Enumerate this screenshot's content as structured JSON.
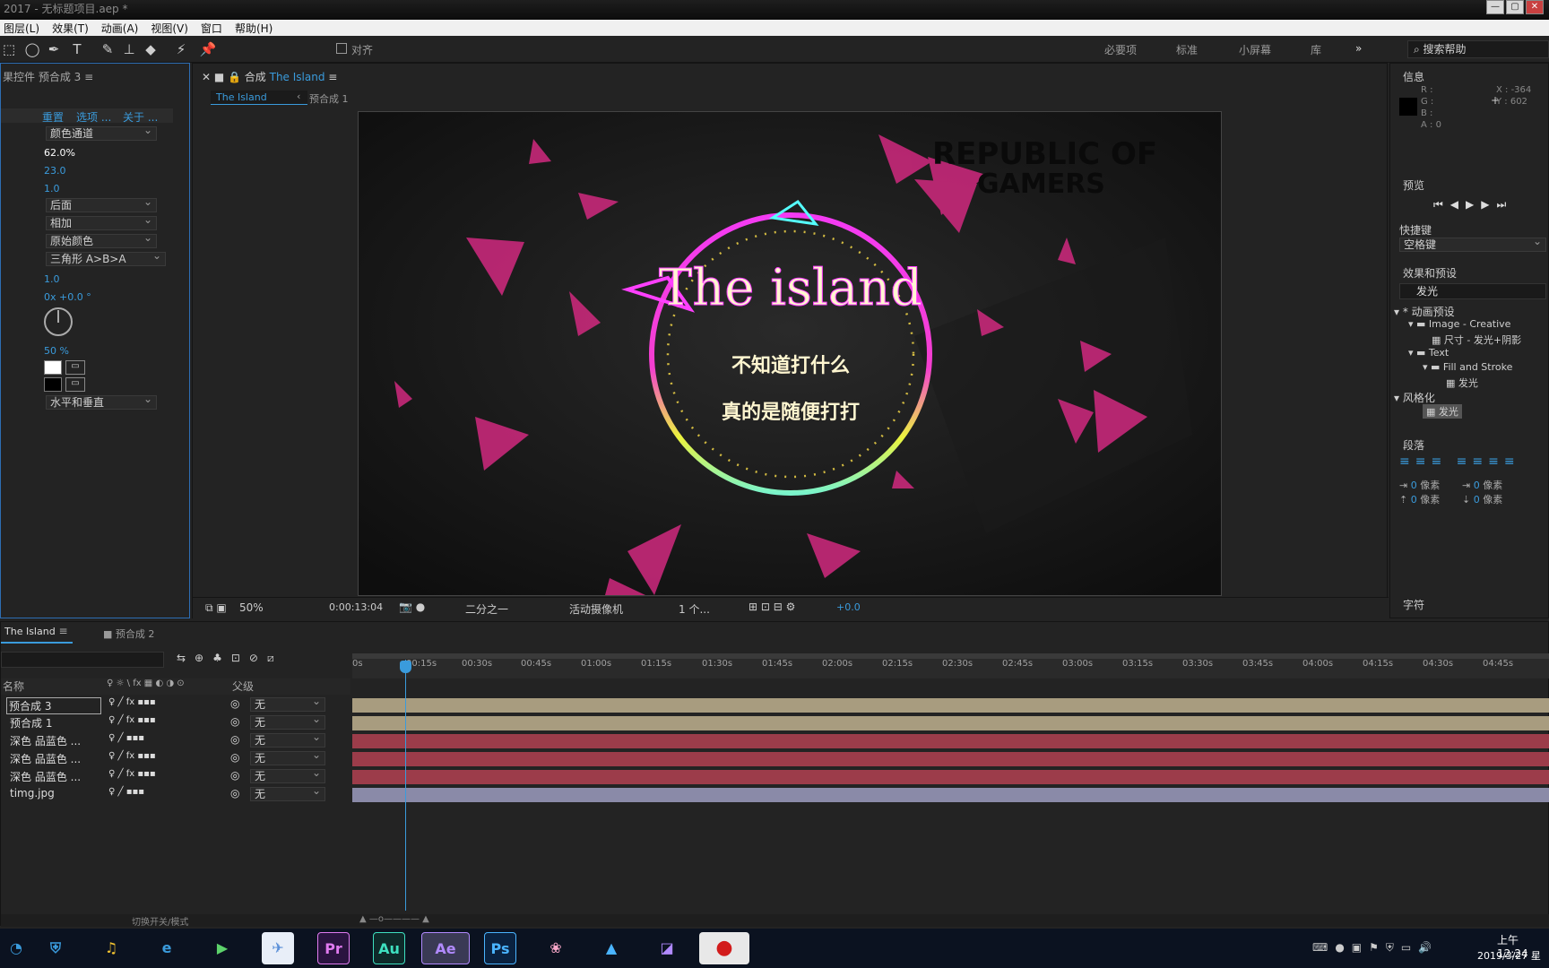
{
  "window": {
    "title": "2017 - 无标题项目.aep *"
  },
  "menu": [
    "图层(L)",
    "效果(T)",
    "动画(A)",
    "视图(V)",
    "窗口",
    "帮助(H)"
  ],
  "toolbar": {
    "align_label": "对齐",
    "workspaces": [
      "必要项",
      "标准",
      "小屏幕",
      "库"
    ],
    "search_help": "搜索帮助"
  },
  "effect_controls": {
    "tab": "果控件 预合成 3",
    "links": [
      "重置",
      "选项 ...",
      "关于 ..."
    ],
    "channel": "颜色通道",
    "value1": "62.0%",
    "value2": "23.0",
    "value3": "1.0",
    "composite": "后面",
    "blend": "相加",
    "color_mode": "原始颜色",
    "gradient": "三角形 A>B>A",
    "value4": "1.0",
    "angle": "0x +0.0 °",
    "percent": "50 %",
    "direction": "水平和垂直"
  },
  "composition": {
    "tab_prefix": "合成",
    "tab_name": "The Island",
    "breadcrumb_active": "The Island",
    "breadcrumb_next": "预合成 1",
    "zoom": "50%",
    "timecode": "0:00:13:04",
    "resolution": "二分之一",
    "camera": "活动摄像机",
    "views": "1 个...",
    "exposure": "+0.0"
  },
  "artwork": {
    "title": "The island",
    "line1": "不知道打什么",
    "line2": "真的是随便打打",
    "watermark1": "REPUBLIC OF",
    "watermark2": "GAMERS"
  },
  "info_panel": {
    "title": "信息",
    "r": "R :",
    "g": "G :",
    "b": "B :",
    "a": "A : 0",
    "x": "X : -364",
    "y": "Y : 602"
  },
  "preview": {
    "title": "预览",
    "shortcut_label": "快捷键",
    "shortcut_value": "空格键"
  },
  "effects_presets": {
    "title": "效果和预设",
    "search": "发光",
    "tree": [
      "* 动画预设",
      "Image - Creative",
      "尺寸 - 发光+阴影",
      "Text",
      "Fill and Stroke",
      "发光",
      "风格化",
      "发光"
    ]
  },
  "paragraph": {
    "title": "段落",
    "px": "像素",
    "zero": "0"
  },
  "character": {
    "title": "字符"
  },
  "timeline": {
    "tab1": "The Island",
    "tab2": "预合成 2",
    "col_name": "名称",
    "col_parent": "父级",
    "switch_mode": "切换开关/模式",
    "ruler": [
      "0s",
      "00:15s",
      "00:30s",
      "00:45s",
      "01:00s",
      "01:15s",
      "01:30s",
      "01:45s",
      "02:00s",
      "02:15s",
      "02:30s",
      "02:45s",
      "03:00s",
      "03:15s",
      "03:30s",
      "03:45s",
      "04:00s",
      "04:15s",
      "04:30s",
      "04:45s"
    ],
    "layers": [
      {
        "name": "预合成 3",
        "parent": "无",
        "color": "#a89c7f"
      },
      {
        "name": "预合成 1",
        "parent": "无",
        "color": "#a89c7f"
      },
      {
        "name": "深色 品蓝色 ...",
        "parent": "无",
        "color": "#9c3c4a"
      },
      {
        "name": "深色 品蓝色 ...",
        "parent": "无",
        "color": "#9c3c4a"
      },
      {
        "name": "深色 品蓝色 ...",
        "parent": "无",
        "color": "#9c3c4a"
      },
      {
        "name": "timg.jpg",
        "parent": "无",
        "color": "#8a8aa8"
      }
    ]
  },
  "taskbar": {
    "time": "12:24",
    "ampm": "上午",
    "date": "2019/3/27 星",
    "apps": [
      "Pr",
      "Au",
      "Ae",
      "Ps"
    ]
  }
}
